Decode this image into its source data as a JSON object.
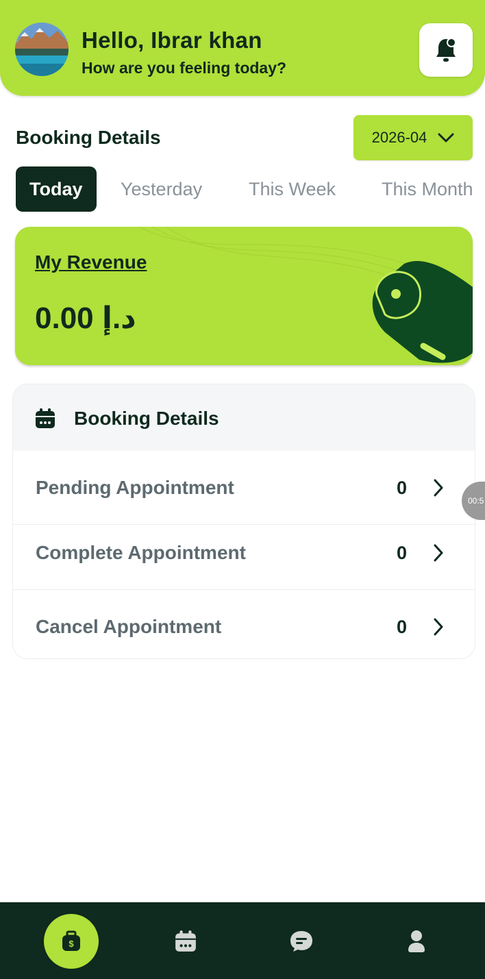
{
  "header": {
    "greeting_title": "Hello,  Ibrar khan",
    "greeting_subtitle": "How are you feeling today?"
  },
  "booking_section": {
    "title": "Booking Details",
    "month_value": "2026-04"
  },
  "tabs": [
    {
      "label": "Today",
      "active": true
    },
    {
      "label": "Yesterday",
      "active": false
    },
    {
      "label": "This Week",
      "active": false
    },
    {
      "label": "This Month",
      "active": false
    }
  ],
  "revenue": {
    "label": "My Revenue",
    "amount": "0.00 د.إ"
  },
  "details_card": {
    "title": "Booking Details",
    "rows": [
      {
        "label": "Pending Appointment",
        "count": "0"
      },
      {
        "label": "Complete Appointment",
        "count": "0"
      },
      {
        "label": "Cancel Appointment",
        "count": "0"
      }
    ]
  },
  "timer_bubble": "00:5",
  "nav": {
    "items": [
      "wallet-icon",
      "calendar-icon",
      "chat-icon",
      "profile-icon"
    ],
    "active_index": 0
  },
  "colors": {
    "accent": "#b0e03a",
    "dark": "#0f2a1e"
  }
}
